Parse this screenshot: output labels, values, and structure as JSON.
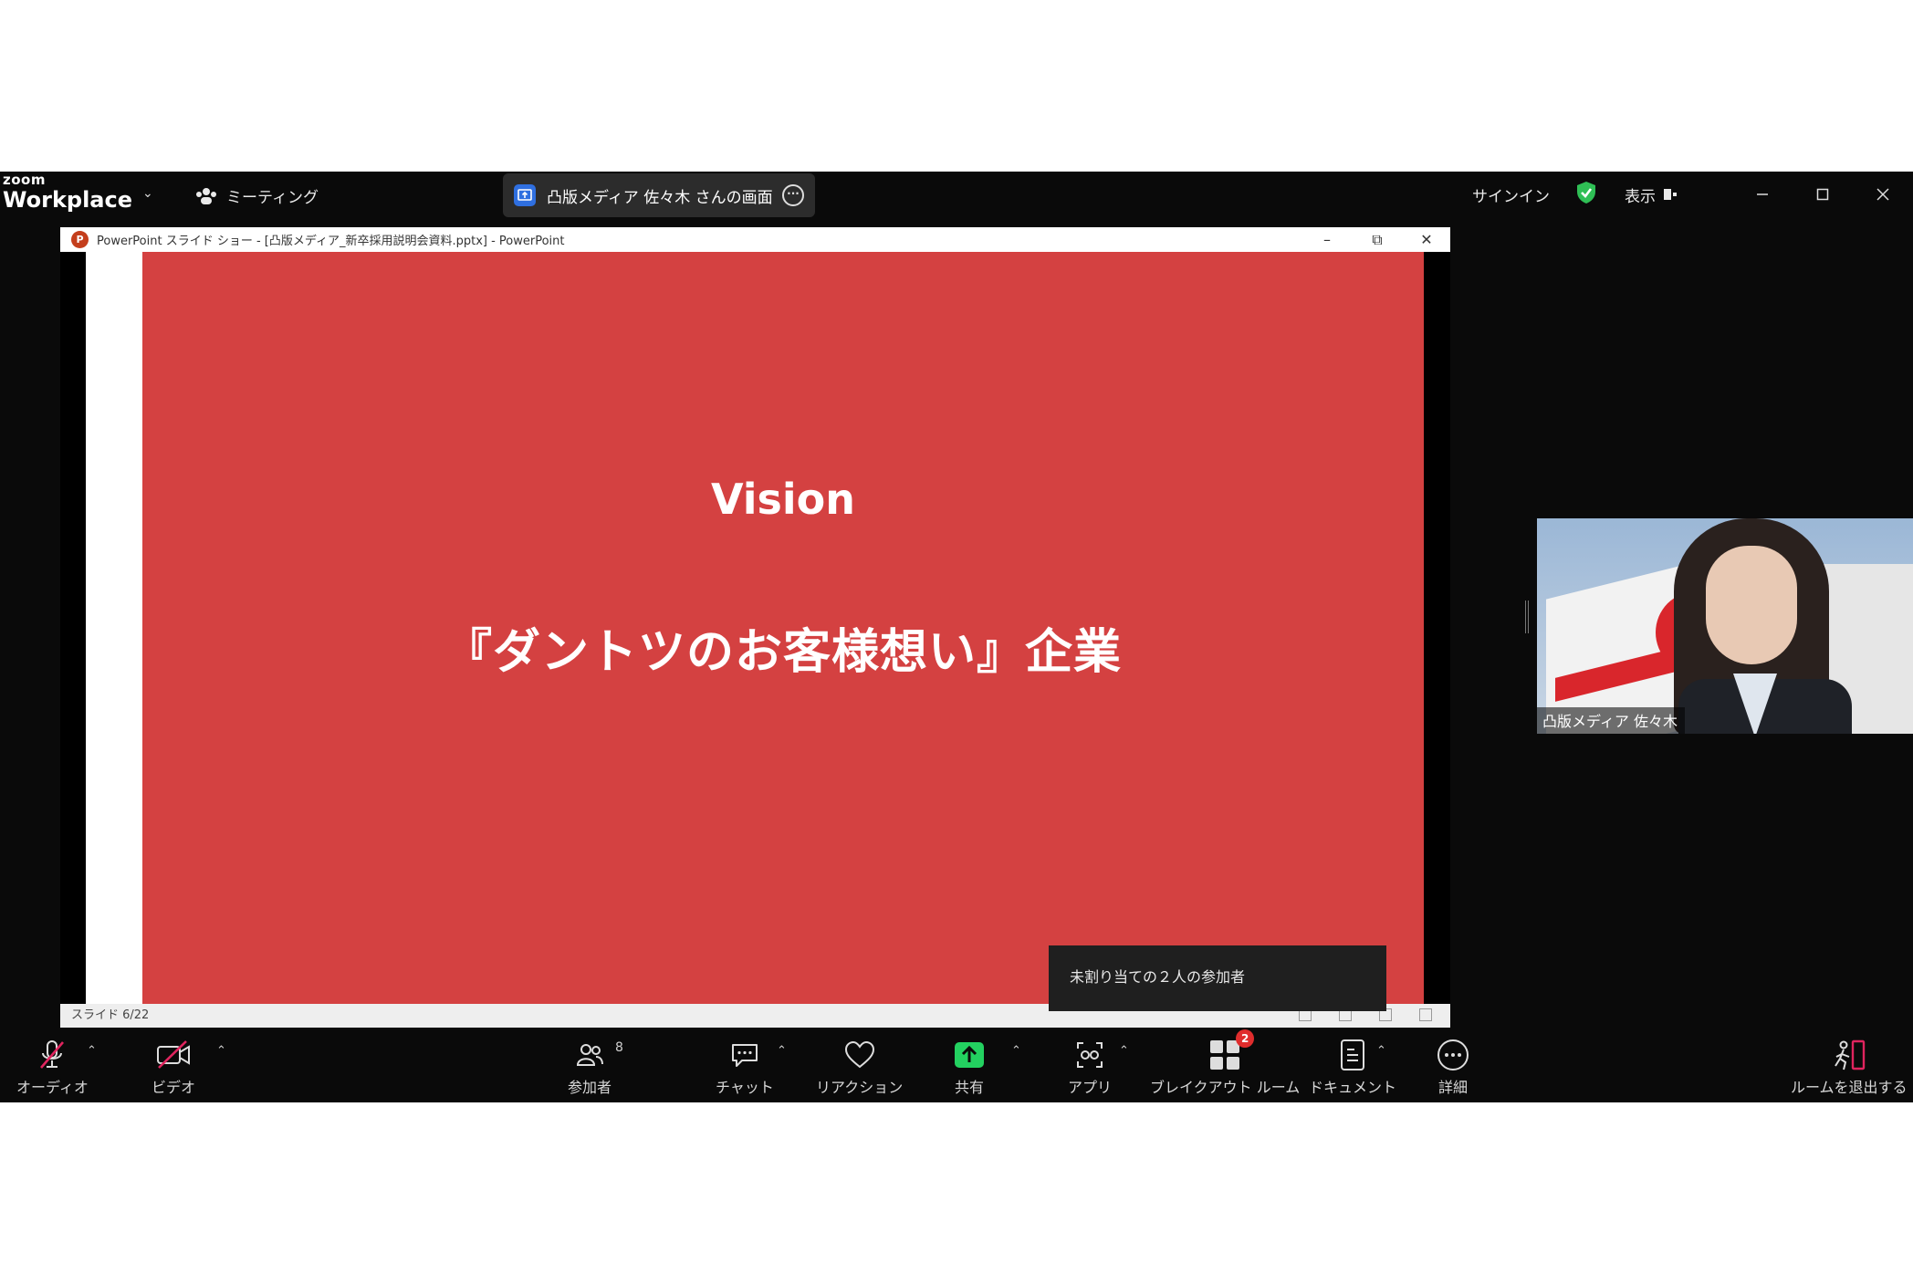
{
  "app": {
    "brand_small": "zoom",
    "brand_large": "Workplace",
    "meeting_menu_label": "ミーティング",
    "share_pill_label": "凸版メディア 佐々木 さんの画面",
    "signin_label": "サインイン",
    "view_label": "表示"
  },
  "ppt": {
    "window_title": "PowerPoint スライド ショー - [凸版メディア_新卒採用説明会資料.pptx] - PowerPoint",
    "slide_title": "Vision",
    "slide_text": "『ダントツのお客様想い』企業",
    "status": "スライド 6/22",
    "slide_color": "#d44141"
  },
  "toast": {
    "text": "未割り当ての２人の参加者"
  },
  "participant": {
    "name": "凸版メディア 佐々木"
  },
  "toolbar": {
    "audio": "オーディオ",
    "video": "ビデオ",
    "participants": "参加者",
    "participants_count": "8",
    "chat": "チャット",
    "reactions": "リアクション",
    "share": "共有",
    "apps": "アプリ",
    "breakout": "ブレイクアウト ルーム",
    "breakout_badge": "2",
    "docs": "ドキュメント",
    "more": "詳細",
    "leave": "ルームを退出する"
  },
  "colors": {
    "share_green": "#23d160",
    "muted_red": "#e0245e",
    "shield_green": "#2fbf55",
    "breakout_badge": "#e02d2d"
  }
}
